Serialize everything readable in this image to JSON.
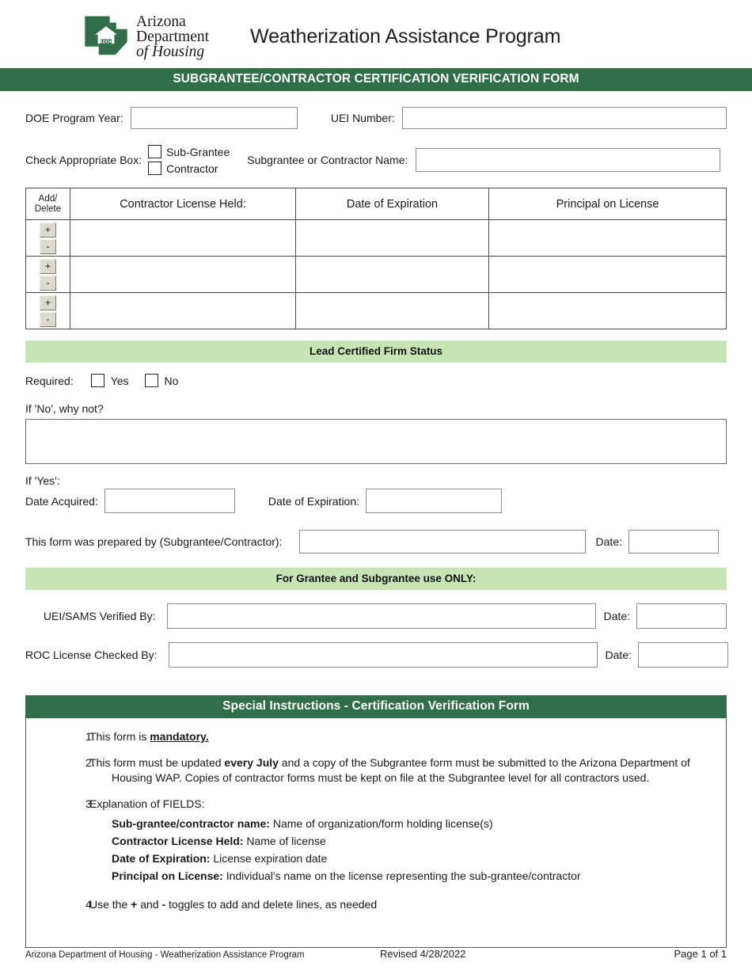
{
  "header": {
    "logo_line1": "Arizona",
    "logo_line2": "Department",
    "logo_line3": "of Housing",
    "logo_badge": "ADOH",
    "app_title": "Weatherization Assistance Program"
  },
  "title_bar": "SUBGRANTEE/CONTRACTOR CERTIFICATION VERIFICATION FORM",
  "form": {
    "doe_program_year_label": "DOE Program Year:",
    "doe_program_year_value": "",
    "uei_number_label": "UEI Number:",
    "uei_number_value": "",
    "check_box_label": "Check Appropriate Box:",
    "sub_grantee_option": "Sub-Grantee",
    "contractor_option": "Contractor",
    "name_label": "Subgrantee or Contractor Name:",
    "name_value": ""
  },
  "license_table": {
    "headers": {
      "add_delete_line1": "Add/",
      "add_delete_line2": "Delete",
      "contractor_license": "Contractor License Held:",
      "date_of_expiration": "Date of Expiration",
      "principal_on_license": "Principal on License"
    },
    "add_symbol": "+",
    "delete_symbol": "-",
    "rows": [
      {
        "license": "",
        "expiration": "",
        "principal": ""
      },
      {
        "license": "",
        "expiration": "",
        "principal": ""
      },
      {
        "license": "",
        "expiration": "",
        "principal": ""
      }
    ]
  },
  "lead_section": {
    "bar_title": "Lead Certified Firm Status",
    "required_label": "Required:",
    "yes_label": "Yes",
    "no_label": "No",
    "if_no_label": "If 'No', why not?",
    "if_no_value": "",
    "if_yes_label": "If 'Yes':",
    "date_acquired_label": "Date Acquired:",
    "date_acquired_value": "",
    "date_expiration_label": "Date of Expiration:",
    "date_expiration_value": "",
    "prepared_by_label": "This form was prepared by (Subgrantee/Contractor):",
    "prepared_by_value": "",
    "prepared_date_label": "Date:",
    "prepared_date_value": ""
  },
  "grantee_section": {
    "bar_title": "For Grantee and Subgrantee use ONLY:",
    "uei_sams_label": "UEI/SAMS Verified By:",
    "uei_sams_value": "",
    "uei_sams_date_label": "Date:",
    "uei_sams_date_value": "",
    "roc_label": "ROC License Checked By:",
    "roc_value": "",
    "roc_date_label": "Date:",
    "roc_date_value": ""
  },
  "instructions": {
    "bar_title": "Special Instructions - Certification Verification Form",
    "item1_num": "1.",
    "item1_pre": "This form is ",
    "item1_bold": "mandatory.",
    "item2_num": "2.",
    "item2_part1": "This form must be updated ",
    "item2_bold": "every July",
    "item2_part2": " and a copy of the Subgrantee form must be submitted to the Arizona Department of",
    "item2_part3": "Housing WAP. Copies of contractor forms must be kept on file at the Subgrantee level for all contractors used.",
    "item3_num": "3.",
    "item3_title": "Explanation of FIELDS:",
    "item3_fields": [
      {
        "name": "Sub-grantee/contractor name:",
        "desc": "Name of organization/form holding license(s)"
      },
      {
        "name": "Contractor License Held:",
        "desc": "Name of license"
      },
      {
        "name": "Date of Expiration:",
        "desc": "License expiration date"
      },
      {
        "name": "Principal on License:",
        "desc": "Individual's name on the license representing the sub-grantee/contractor"
      }
    ],
    "item4_num": "4.",
    "item4_pre": "Use the ",
    "item4_plus": "+",
    "item4_mid": " and ",
    "item4_minus": "-",
    "item4_post": " toggles to add and delete lines, as needed"
  },
  "footer": {
    "left": "Arizona  Department of Housing -  Weatherization Assistance Program",
    "middle": "Revised 4/28/2022",
    "right": "Page 1 of 1"
  },
  "colors": {
    "dark_green": "#2f6e49",
    "light_green": "#c6e5b3",
    "button_beige": "#ddd9ce"
  }
}
